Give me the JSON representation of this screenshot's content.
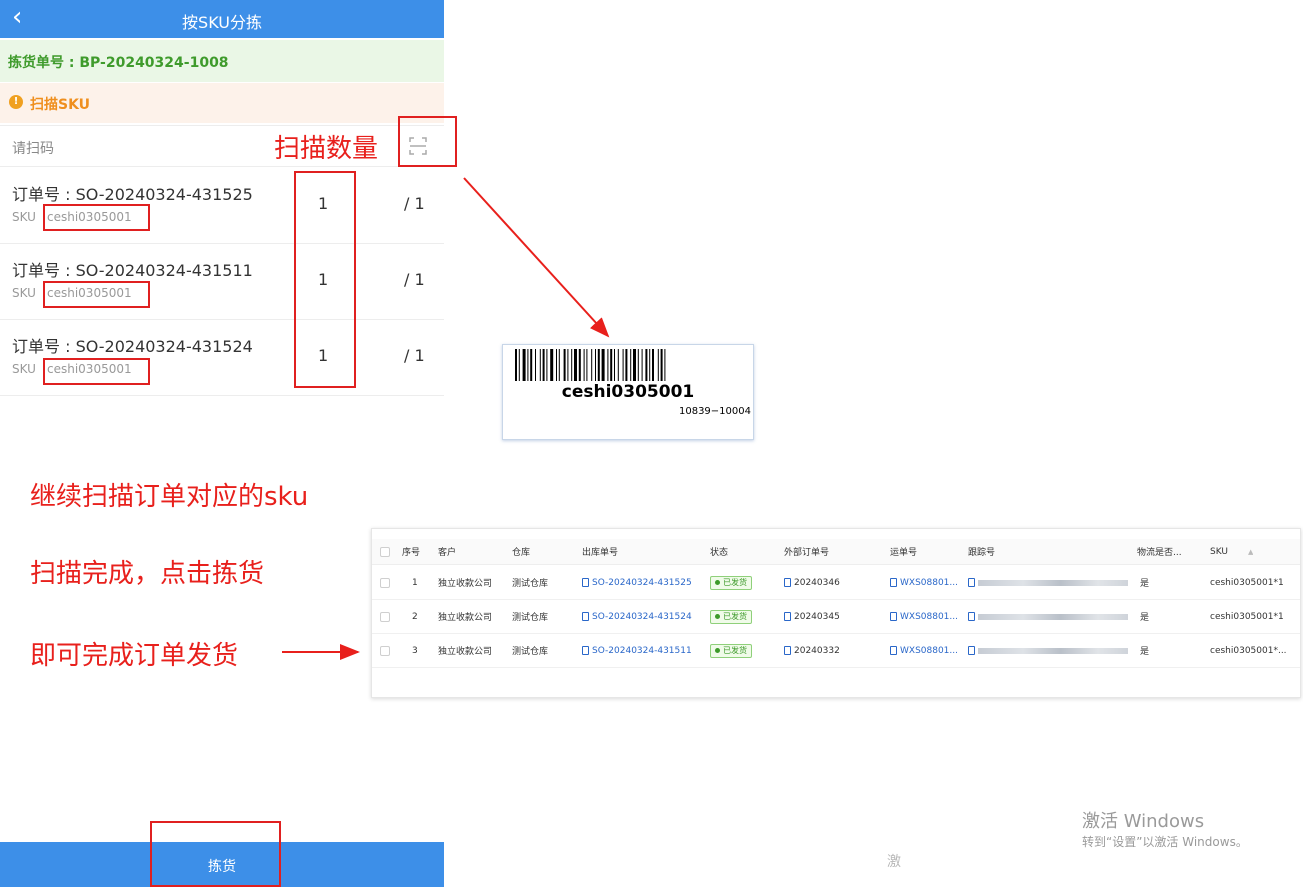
{
  "mobile": {
    "title": "按SKU分拣",
    "back_icon": "chevron-left-icon",
    "pick_order": "拣货单号 : BP-20240324-1008",
    "scan_section_label": "扫描SKU",
    "scan_input_placeholder": "请扫码",
    "rows": [
      {
        "order": "订单号 : SO-20240324-431525",
        "sku_label": "SKU",
        "sku": "ceshi0305001",
        "scanned": "1",
        "total": "/ 1"
      },
      {
        "order": "订单号 : SO-20240324-431511",
        "sku_label": "SKU",
        "sku": "ceshi0305001",
        "scanned": "1",
        "total": "/ 1"
      },
      {
        "order": "订单号 : SO-20240324-431524",
        "sku_label": "SKU",
        "sku": "ceshi0305001",
        "scanned": "1",
        "total": "/ 1"
      }
    ],
    "pick_button": "拣货",
    "colors": {
      "header": "#3d8fe8",
      "order_bar": "#eaf7e6",
      "order_text": "#3f9b2c",
      "hint_bar": "#fdf2ea",
      "hint_text": "#ef8f1e"
    }
  },
  "annotations": {
    "scan_count": "扫描数量",
    "continue": "继续扫描订单对应的sku",
    "done": "扫描完成，点击拣货",
    "finish": "即可完成订单发货",
    "color": "#e8201c"
  },
  "barcode": {
    "sku": "ceshi0305001",
    "code": "10839−10004"
  },
  "table": {
    "columns": [
      "序号",
      "客户",
      "仓库",
      "出库单号",
      "状态",
      "外部订单号",
      "运单号",
      "跟踪号",
      "物流是否...",
      "SKU"
    ],
    "rows": [
      {
        "index": "1",
        "customer": "独立收款公司",
        "warehouse": "测试仓库",
        "outbound": "SO-20240324-431525",
        "status": "已发货",
        "external": "20240346",
        "waybill": "WXS08801...",
        "logistics": "是",
        "sku": "ceshi0305001*1"
      },
      {
        "index": "2",
        "customer": "独立收款公司",
        "warehouse": "测试仓库",
        "outbound": "SO-20240324-431524",
        "status": "已发货",
        "external": "20240345",
        "waybill": "WXS08801...",
        "logistics": "是",
        "sku": "ceshi0305001*1"
      },
      {
        "index": "3",
        "customer": "独立收款公司",
        "warehouse": "测试仓库",
        "outbound": "SO-20240324-431511",
        "status": "已发货",
        "external": "20240332",
        "waybill": "WXS08801...",
        "logistics": "是",
        "sku": "ceshi0305001*..."
      }
    ],
    "colors": {
      "link": "#2a67c9",
      "status": "#3d9a2a"
    }
  },
  "windows": {
    "activate_title": "激活 Windows",
    "activate_sub": "转到“设置”以激活 Windows。",
    "stray_text": "激"
  }
}
